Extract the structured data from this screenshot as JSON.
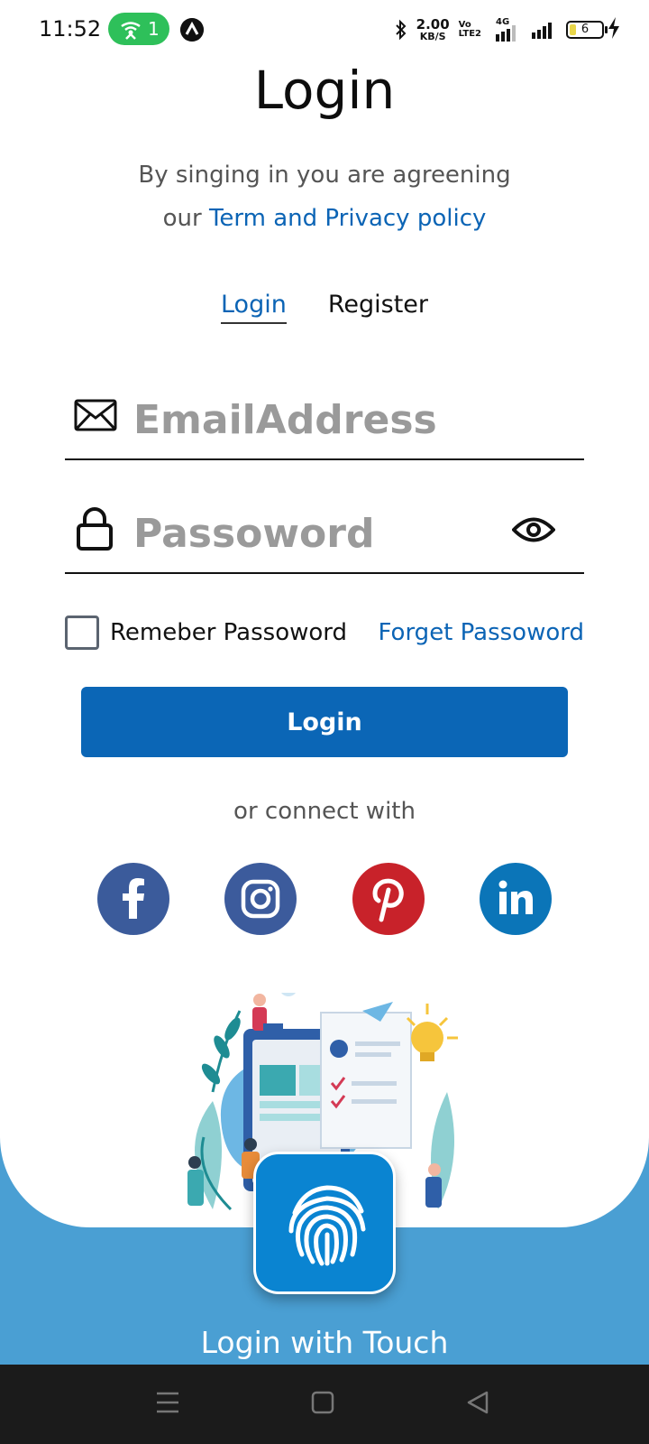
{
  "status_bar": {
    "time": "11:52",
    "hotspot_count": "1",
    "speed_value": "2.00",
    "speed_unit": "KB/S",
    "volte_top": "Vo",
    "volte_bottom": "LTE2",
    "network": "4G",
    "battery": "6",
    "icons": [
      "hotspot-icon",
      "app-icon",
      "bluetooth-icon",
      "signal-icon",
      "battery-icon",
      "charging-icon"
    ]
  },
  "header": {
    "title": "Login",
    "agree_line1": "By singing in you are agreening",
    "agree_prefix": "our ",
    "agree_link": "Term and Privacy policy"
  },
  "tabs": [
    {
      "label": "Login",
      "active": true
    },
    {
      "label": "Register",
      "active": false
    }
  ],
  "form": {
    "email_placeholder": "EmailAddress",
    "email_value": "",
    "password_placeholder": "Passoword",
    "password_value": "",
    "remember_label": "Remeber Passoword",
    "remember_checked": false,
    "forget_label": "Forget Passoword",
    "login_button": "Login"
  },
  "social": {
    "label": "or connect with",
    "items": [
      {
        "name": "facebook",
        "color": "#3b5b9b"
      },
      {
        "name": "instagram",
        "color": "#3c5b9c"
      },
      {
        "name": "pinterest",
        "color": "#c8222a"
      },
      {
        "name": "linkedin",
        "color": "#0b75b8"
      }
    ]
  },
  "touch": {
    "label": "Login with Touch",
    "color": "#4a9fd3"
  },
  "colors": {
    "accent": "#0b66b6",
    "link": "#0b64b5"
  }
}
